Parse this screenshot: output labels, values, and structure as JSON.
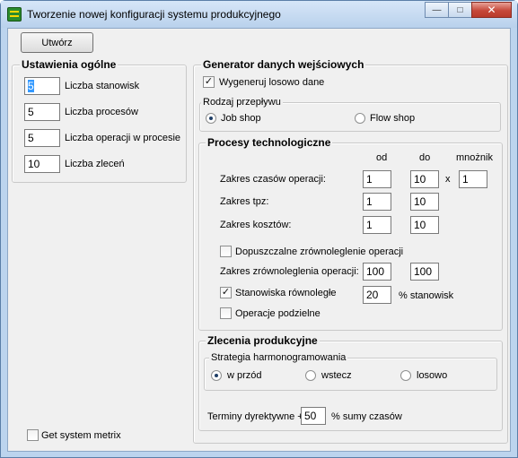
{
  "window": {
    "title": "Tworzenie nowej konfiguracji systemu produkcyjnego",
    "minimize": "—",
    "maximize": "□",
    "close": "✕"
  },
  "create_button": "Utwórz",
  "general": {
    "title": "Ustawienia ogólne",
    "fields": [
      {
        "label": "Liczba stanowisk",
        "value": "5"
      },
      {
        "label": "Liczba procesów",
        "value": "5"
      },
      {
        "label": "Liczba operacji w procesie",
        "value": "5"
      },
      {
        "label": "Liczba zleceń",
        "value": "10"
      }
    ]
  },
  "generator": {
    "title": "Generator danych wejściowych",
    "random_label": "Wygeneruj losowo dane",
    "random_checked": true,
    "flow_type": {
      "title": "Rodzaj przepływu",
      "options": [
        "Job shop",
        "Flow shop"
      ],
      "selected": "Job shop"
    }
  },
  "processes": {
    "title": "Procesy technologiczne",
    "col_from": "od",
    "col_to": "do",
    "col_multiplier": "mnożnik",
    "times_label": "Zakres czasów operacji:",
    "times_from": "1",
    "times_to": "10",
    "times_x": "x",
    "times_mult": "1",
    "tpz_label": "Zakres tpz:",
    "tpz_from": "1",
    "tpz_to": "10",
    "cost_label": "Zakres kosztów:",
    "cost_from": "1",
    "cost_to": "10",
    "parallel_allowed_label": "Dopuszczalne zrównoleglenie operacji",
    "parallel_allowed_checked": false,
    "parallel_range_label": "Zakres zrównoleglenia operacji:",
    "parallel_from": "100",
    "parallel_to": "100",
    "parallel_stations_label": "Stanowiska równoległe",
    "parallel_stations_checked": true,
    "parallel_stations_value": "20",
    "parallel_stations_unit": "% stanowisk",
    "divisible_label": "Operacje podzielne",
    "divisible_checked": false
  },
  "orders": {
    "title": "Zlecenia produkcyjne",
    "strategy": {
      "title": "Strategia harmonogramowania",
      "options": [
        "w przód",
        "wstecz",
        "losowo"
      ],
      "selected": "w przód"
    },
    "deadline_label": "Terminy dyrektywne +",
    "deadline_value": "50",
    "deadline_unit": "% sumy czasów"
  },
  "metrix": {
    "label": "Get system metrix",
    "checked": false
  }
}
